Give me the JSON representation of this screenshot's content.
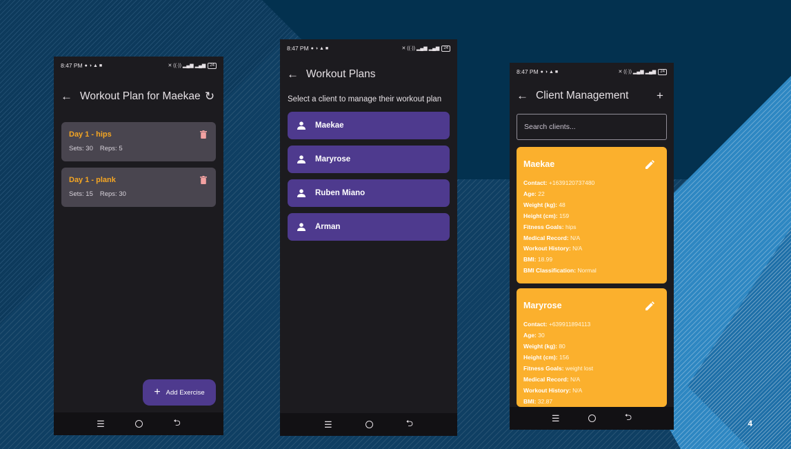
{
  "slide": {
    "number": "4"
  },
  "phone1": {
    "status": {
      "time": "8:47 PM",
      "battery": "24"
    },
    "title": "Workout Plan for Maekae",
    "exercises": [
      {
        "title": "Day 1 - hips",
        "sets": "Sets: 30",
        "reps": "Reps: 5"
      },
      {
        "title": "Day 1 - plank",
        "sets": "Sets: 15",
        "reps": "Reps: 30"
      }
    ],
    "fab_label": "Add Exercise",
    "colors": {
      "accent": "#f5a623",
      "fab": "#4e3a8e",
      "delete": "#f2a1a1"
    }
  },
  "phone2": {
    "status": {
      "time": "8:47 PM",
      "battery": "24"
    },
    "title": "Workout Plans",
    "subtitle": "Select a client to manage their workout plan",
    "clients": [
      "Maekae",
      "Maryrose",
      "Ruben Miano",
      "Arman"
    ]
  },
  "phone3": {
    "status": {
      "time": "8:47 PM",
      "battery": "24"
    },
    "title": "Client Management",
    "search_placeholder": "Search clients...",
    "cards": [
      {
        "name": "Maekae",
        "fields": [
          {
            "label": "Contact:",
            "value": "+1639120737480"
          },
          {
            "label": "Age:",
            "value": "22"
          },
          {
            "label": "Weight (kg):",
            "value": "48"
          },
          {
            "label": "Height (cm):",
            "value": "159"
          },
          {
            "label": "Fitness Goals:",
            "value": "hips"
          },
          {
            "label": "Medical Record:",
            "value": "N/A"
          },
          {
            "label": "Workout History:",
            "value": "N/A"
          },
          {
            "label": "BMI:",
            "value": "18.99"
          },
          {
            "label": "BMI Classification:",
            "value": "Normal"
          }
        ]
      },
      {
        "name": "Maryrose",
        "fields": [
          {
            "label": "Contact:",
            "value": "+639911894113"
          },
          {
            "label": "Age:",
            "value": "30"
          },
          {
            "label": "Weight (kg):",
            "value": "80"
          },
          {
            "label": "Height (cm):",
            "value": "156"
          },
          {
            "label": "Fitness Goals:",
            "value": "weight lost"
          },
          {
            "label": "Medical Record:",
            "value": "N/A"
          },
          {
            "label": "Workout History:",
            "value": "N/A"
          },
          {
            "label": "BMI:",
            "value": "32.87"
          }
        ]
      }
    ],
    "colors": {
      "card": "#fbb02d"
    }
  }
}
